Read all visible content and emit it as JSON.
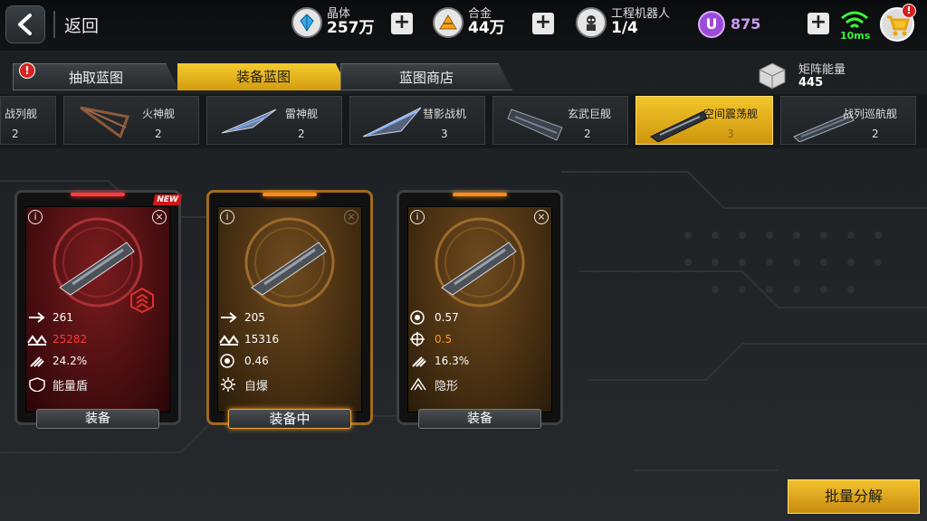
{
  "header": {
    "back_label": "返回",
    "resources": [
      {
        "name": "晶体",
        "value": "257万",
        "icon": "crystal-icon"
      },
      {
        "name": "合金",
        "value": "44万",
        "icon": "alloy-icon"
      },
      {
        "name": "工程机器人",
        "value": "1/4",
        "icon": "robot-icon"
      }
    ],
    "currency_u": {
      "letter": "U",
      "value": "875"
    },
    "plus_label": "+",
    "ping": "10ms",
    "cart_badge": "!"
  },
  "tabs": [
    {
      "label": "抽取蓝图",
      "active": false,
      "badge": "!"
    },
    {
      "label": "装备蓝图",
      "active": true
    },
    {
      "label": "蓝图商店",
      "active": false
    }
  ],
  "matrix_energy": {
    "name": "矩阵能量",
    "value": "445"
  },
  "ships": [
    {
      "name": "战列舰",
      "count": "2",
      "active": false
    },
    {
      "name": "火神舰",
      "count": "2",
      "active": false
    },
    {
      "name": "雷神舰",
      "count": "2",
      "active": false
    },
    {
      "name": "彗影战机",
      "count": "3",
      "active": false
    },
    {
      "name": "玄武巨舰",
      "count": "2",
      "active": false
    },
    {
      "name": "空间震荡舰",
      "count": "3",
      "active": true
    },
    {
      "name": "战列巡航舰",
      "count": "2",
      "active": false
    }
  ],
  "cards": [
    {
      "theme": "red",
      "new_tag": "NEW",
      "stats": [
        {
          "icon": "speed-icon",
          "value": "261",
          "style": ""
        },
        {
          "icon": "hp-icon",
          "value": "25282",
          "style": "red"
        },
        {
          "icon": "missile-icon",
          "value": "24.2%",
          "style": ""
        }
      ],
      "ability": {
        "icon": "shield-icon",
        "label": "能量盾"
      },
      "button": "装备"
    },
    {
      "theme": "orange",
      "equipped": true,
      "stats": [
        {
          "icon": "speed-icon",
          "value": "205",
          "style": ""
        },
        {
          "icon": "hp-icon",
          "value": "15316",
          "style": ""
        },
        {
          "icon": "radar-icon",
          "value": "0.46",
          "style": ""
        }
      ],
      "ability": {
        "icon": "explode-icon",
        "label": "自爆"
      },
      "button": "装备中"
    },
    {
      "theme": "orange",
      "stats": [
        {
          "icon": "radar-icon",
          "value": "0.57",
          "style": ""
        },
        {
          "icon": "crosshair-icon",
          "value": "0.5",
          "style": "orange"
        },
        {
          "icon": "missile-icon",
          "value": "16.3%",
          "style": ""
        }
      ],
      "ability": {
        "icon": "stealth-icon",
        "label": "隐形"
      },
      "button": "装备"
    }
  ],
  "bulk_button": "批量分解"
}
